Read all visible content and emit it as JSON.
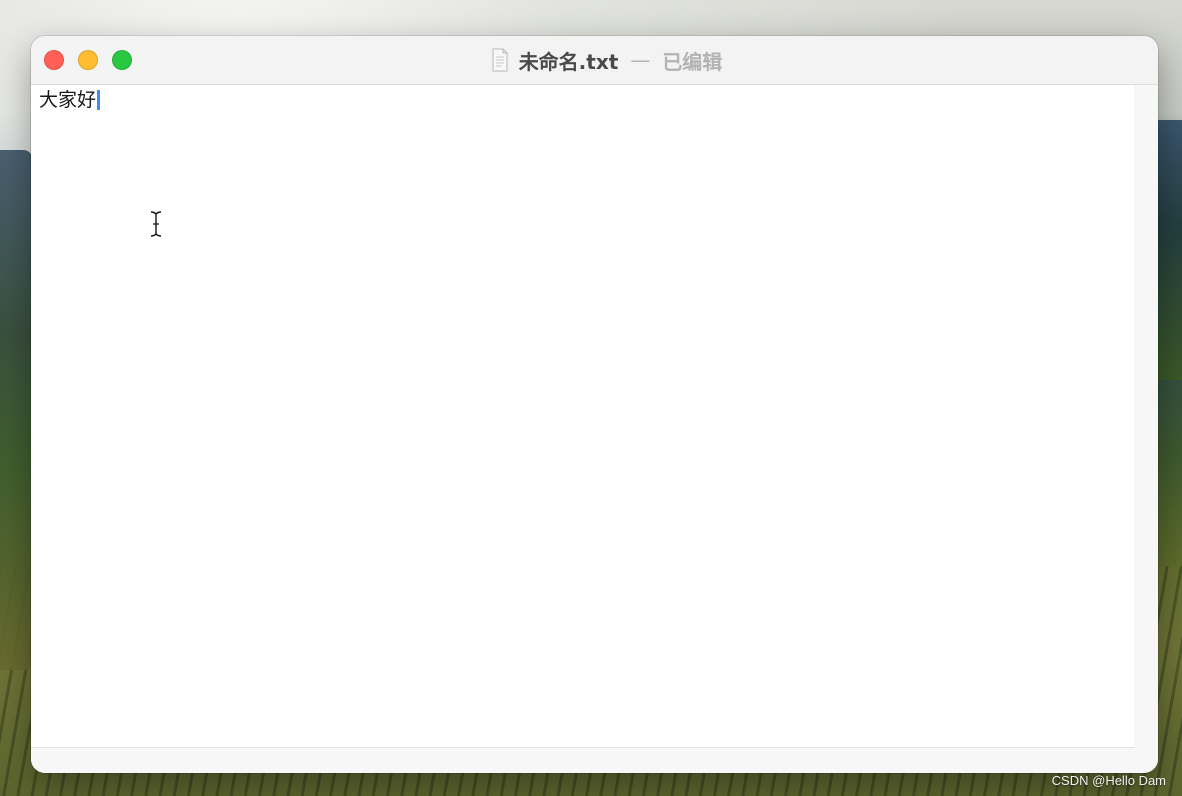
{
  "window": {
    "file_name": "未命名.txt",
    "separator": "—",
    "status": "已编辑"
  },
  "editor": {
    "text": "大家好"
  },
  "watermark": {
    "text": "CSDN @Hello Dam"
  },
  "colors": {
    "close": "#ff5f57",
    "minimize": "#febc2e",
    "zoom": "#28c840",
    "caret": "#3c8cff"
  },
  "icons": {
    "document": "document-icon",
    "cursor": "i-beam-cursor-icon"
  }
}
